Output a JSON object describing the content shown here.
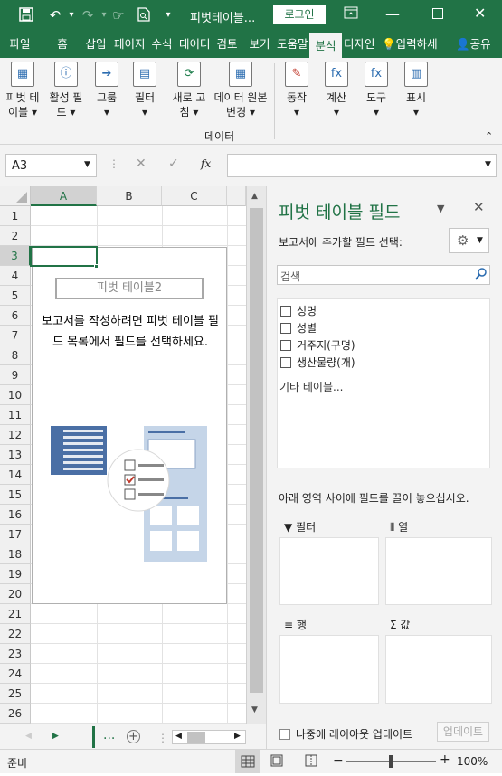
{
  "titlebar": {
    "filename": "피벗테이블...",
    "login": "로그인",
    "icons": [
      "save-icon",
      "undo-icon",
      "redo-icon",
      "touch-mode-icon",
      "print-preview-icon",
      "customize-icon"
    ]
  },
  "tabs": [
    "파일",
    "홈",
    "삽입",
    "페이지",
    "수식",
    "데이터",
    "검토",
    "보기",
    "도움말",
    "분석",
    "디자인"
  ],
  "tell_me": "입력하세",
  "share": "공유",
  "ribbon": {
    "pivot_table": [
      "피벗 테",
      "이블"
    ],
    "active_field": [
      "활성 필",
      "드"
    ],
    "group": "그룹",
    "filter": "필터",
    "refresh": [
      "새로 고",
      "침"
    ],
    "change_source": [
      "데이터 원본",
      "변경"
    ],
    "actions": "동작",
    "calculations": "계산",
    "tools": "도구",
    "show": "표시",
    "group_label": "데이터"
  },
  "formula_bar": {
    "name_box": "A3",
    "cancel": "✕",
    "enter": "✓",
    "fx": "fx",
    "value": ""
  },
  "grid": {
    "columns": [
      "A",
      "B",
      "C"
    ],
    "rows": [
      "1",
      "2",
      "3",
      "4",
      "5",
      "6",
      "7",
      "8",
      "9",
      "10",
      "11",
      "12",
      "13",
      "14",
      "15",
      "16",
      "17",
      "18",
      "19",
      "20",
      "21",
      "22",
      "23",
      "24",
      "25",
      "26"
    ],
    "pivot_title": "피벗 테이블2",
    "pivot_hint": "보고서를 작성하려면 피벗 테이블 필드 목록에서 필드를 선택하세요."
  },
  "sheet_tabs": {
    "ellipsis": "...",
    "add": "+"
  },
  "fields_pane": {
    "title": "피벗 테이블 필드",
    "choose_label": "보고서에 추가할 필드 선택:",
    "search_placeholder": "검색",
    "fields": [
      {
        "label": "성명",
        "checked": false
      },
      {
        "label": "성별",
        "checked": false
      },
      {
        "label": "거주지(구명)",
        "checked": false
      },
      {
        "label": "생산물량(개)",
        "checked": false
      }
    ],
    "more_tables": "기타 테이블...",
    "drag_hint": "아래 영역 사이에 필드를 끌어 놓으십시오.",
    "areas": {
      "filter": "필터",
      "columns": "열",
      "rows": "행",
      "values": "값"
    },
    "defer": "나중에 레이아웃 업데이트",
    "update": "업데이트"
  },
  "status": {
    "ready": "준비",
    "zoom": "100%",
    "minus": "−",
    "plus": "+"
  }
}
